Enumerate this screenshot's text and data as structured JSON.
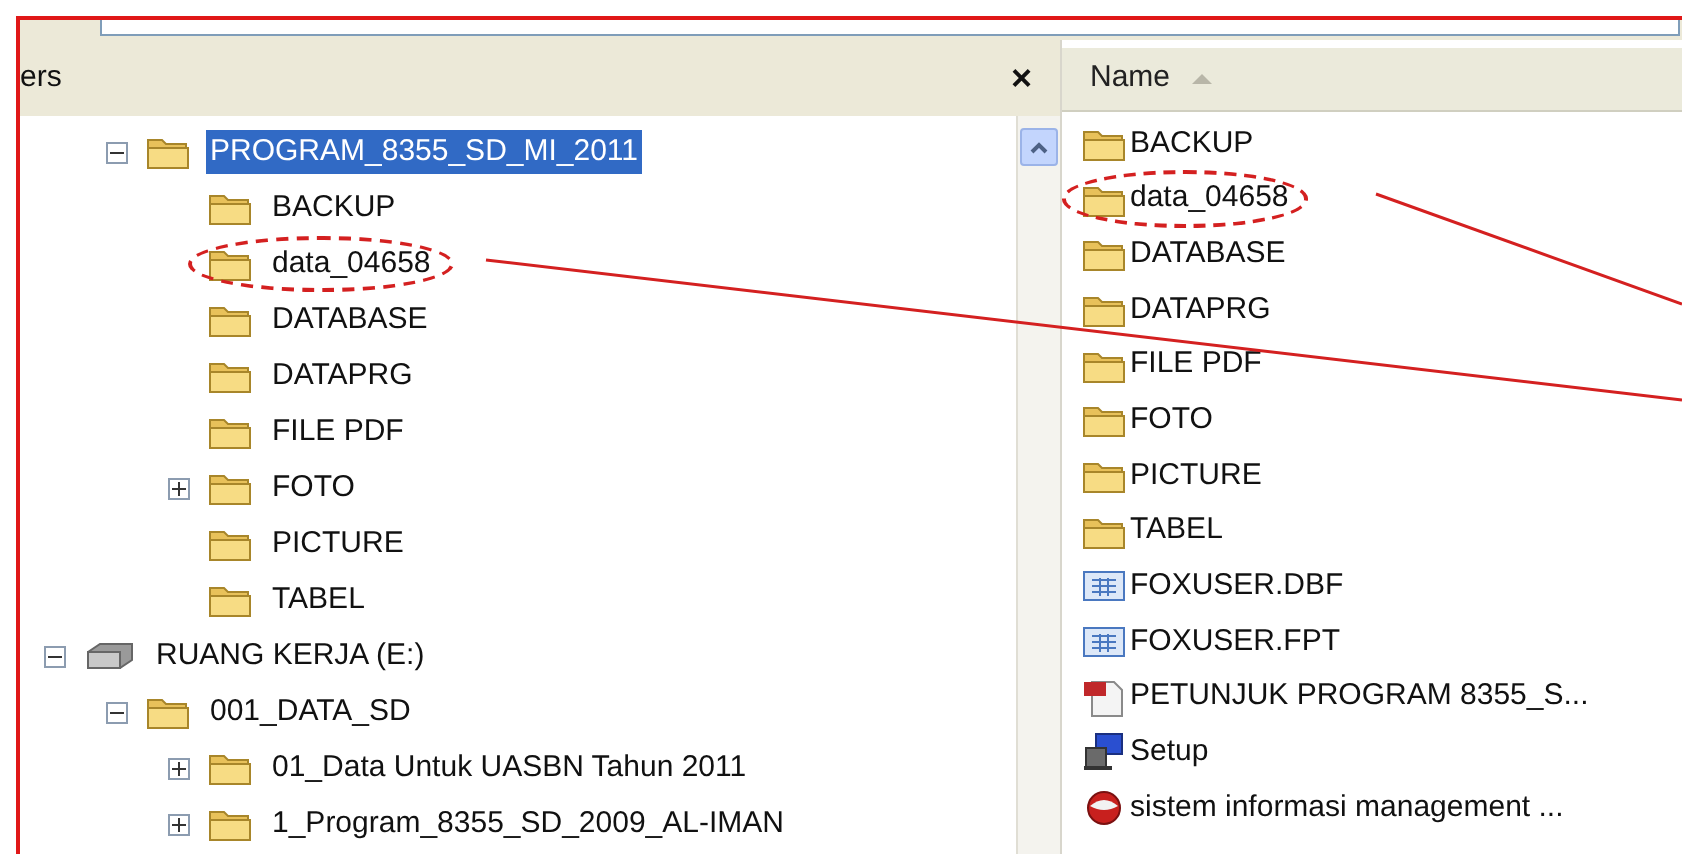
{
  "folders_pane": {
    "title": "ers",
    "close": "×"
  },
  "tree": {
    "open_branch": [
      {
        "label": "PROGRAM_8355_SD_MI_2011",
        "kind": "folder",
        "expandable": true,
        "expanded": true,
        "selected": true,
        "circled": false,
        "children": [
          {
            "label": "BACKUP",
            "kind": "folder",
            "expandable": false,
            "selected": false,
            "circled": false
          },
          {
            "label": "data_04658",
            "kind": "folder",
            "expandable": false,
            "selected": false,
            "circled": true
          },
          {
            "label": "DATABASE",
            "kind": "folder",
            "expandable": false,
            "selected": false,
            "circled": false
          },
          {
            "label": "DATAPRG",
            "kind": "folder",
            "expandable": false,
            "selected": false,
            "circled": false
          },
          {
            "label": "FILE PDF",
            "kind": "folder",
            "expandable": false,
            "selected": false,
            "circled": false
          },
          {
            "label": "FOTO",
            "kind": "folder",
            "expandable": true,
            "expanded": false,
            "selected": false,
            "circled": false
          },
          {
            "label": "PICTURE",
            "kind": "folder",
            "expandable": false,
            "selected": false,
            "circled": false
          },
          {
            "label": "TABEL",
            "kind": "folder",
            "expandable": false,
            "selected": false,
            "circled": false
          }
        ]
      }
    ],
    "roots": [
      {
        "label": "RUANG KERJA (E:)",
        "kind": "drive",
        "expandable": true,
        "expanded": true,
        "selected": false,
        "circled": false,
        "children": [
          {
            "label": "001_DATA_SD",
            "kind": "folder",
            "expandable": true,
            "expanded": true,
            "selected": false,
            "circled": false,
            "children": [
              {
                "label": "01_Data Untuk UASBN Tahun 2011",
                "kind": "folder",
                "expandable": true,
                "expanded": false,
                "selected": false,
                "circled": false
              },
              {
                "label": "1_Program_8355_SD_2009_AL-IMAN",
                "kind": "folder",
                "expandable": true,
                "expanded": false,
                "selected": false,
                "circled": false
              }
            ]
          }
        ]
      }
    ]
  },
  "file_list": {
    "columns": [
      {
        "label": "Name",
        "sorted": true
      }
    ],
    "items": [
      {
        "name": "BACKUP",
        "kind": "folder",
        "circled": false
      },
      {
        "name": "data_04658",
        "kind": "folder",
        "circled": true
      },
      {
        "name": "DATABASE",
        "kind": "folder",
        "circled": false
      },
      {
        "name": "DATAPRG",
        "kind": "folder",
        "circled": false
      },
      {
        "name": "FILE PDF",
        "kind": "folder",
        "circled": false
      },
      {
        "name": "FOTO",
        "kind": "folder",
        "circled": false
      },
      {
        "name": "PICTURE",
        "kind": "folder",
        "circled": false
      },
      {
        "name": "TABEL",
        "kind": "folder",
        "circled": false
      },
      {
        "name": "FOXUSER.DBF",
        "kind": "table",
        "circled": false
      },
      {
        "name": "FOXUSER.FPT",
        "kind": "table",
        "circled": false
      },
      {
        "name": "PETUNJUK PROGRAM 8355_S...",
        "kind": "pdf",
        "circled": false
      },
      {
        "name": "Setup",
        "kind": "setup",
        "circled": false
      },
      {
        "name": "sistem informasi management ...",
        "kind": "app",
        "circled": false
      }
    ]
  }
}
